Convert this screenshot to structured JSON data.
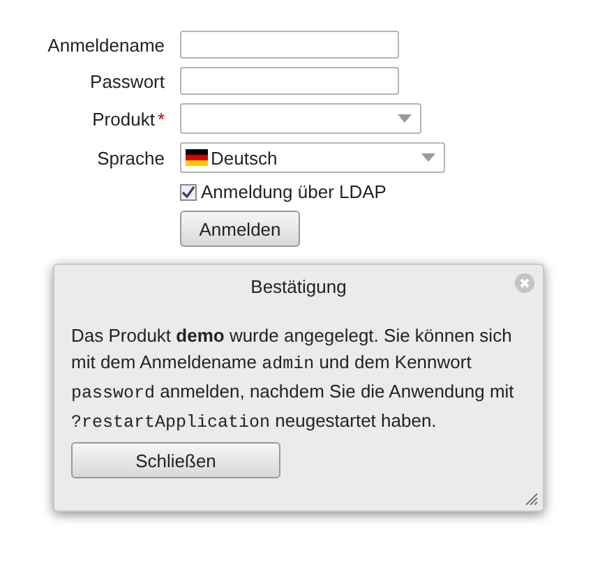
{
  "form": {
    "fields": [
      {
        "kind": "text",
        "label": "Anmeldename"
      },
      {
        "kind": "text",
        "label": "Passwort"
      },
      {
        "kind": "select",
        "label": "Produkt",
        "required_mark": "*"
      },
      {
        "kind": "select",
        "label": "Sprache",
        "value": "Deutsch",
        "flag": true
      }
    ],
    "ldap": {
      "label": "Anmeldung über LDAP",
      "checked": true
    },
    "submit": "Anmelden"
  },
  "dialog": {
    "title": "Bestätigung",
    "message": [
      {
        "kind": "text",
        "text": "Das Produkt "
      },
      {
        "kind": "bold",
        "text": "demo"
      },
      {
        "kind": "text",
        "text": " wurde angegelegt. Sie können sich mit dem Anmeldename "
      },
      {
        "kind": "code",
        "text": "admin"
      },
      {
        "kind": "text",
        "text": " und dem Kennwort "
      },
      {
        "kind": "code",
        "text": "password"
      },
      {
        "kind": "text",
        "text": " anmelden, nachdem Sie die Anwendung mit "
      },
      {
        "kind": "code",
        "text": "?restartApplication"
      },
      {
        "kind": "text",
        "text": " neugestartet haben."
      }
    ],
    "button": "Schließen"
  }
}
